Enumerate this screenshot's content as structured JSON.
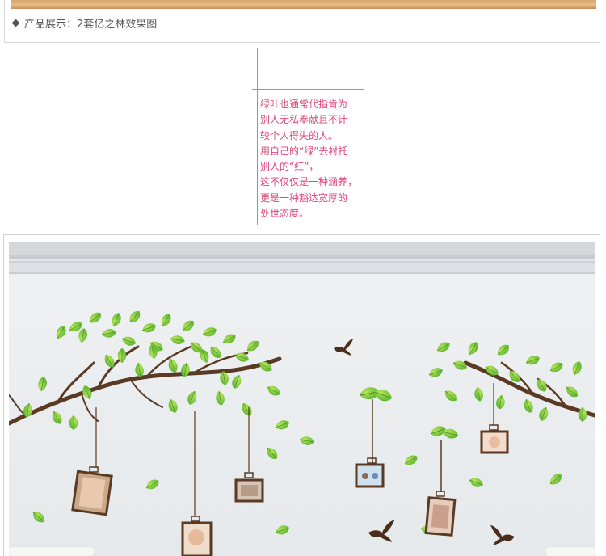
{
  "top": {
    "title": "产品展示：2套亿之林效果图"
  },
  "poem": {
    "lines": [
      "绿叶也通常代指肯为",
      "别人无私奉献且不计",
      "较个人得失的人。",
      "用自己的“绿”去衬托",
      "别人的“红”，",
      "这不仅仅是一种涵养，",
      "更是一种豁达宽厚的",
      "处世态度。"
    ]
  },
  "colors": {
    "poem_text": "#e3457e",
    "divider": "#e2709a",
    "leaf_green": "#6cc43a",
    "branch_brown": "#5a3a22",
    "wall": "#e9ecee"
  },
  "icons": [
    "diamond-bullet-icon",
    "bird-icon",
    "leaf-icon",
    "photo-frame-icon"
  ]
}
